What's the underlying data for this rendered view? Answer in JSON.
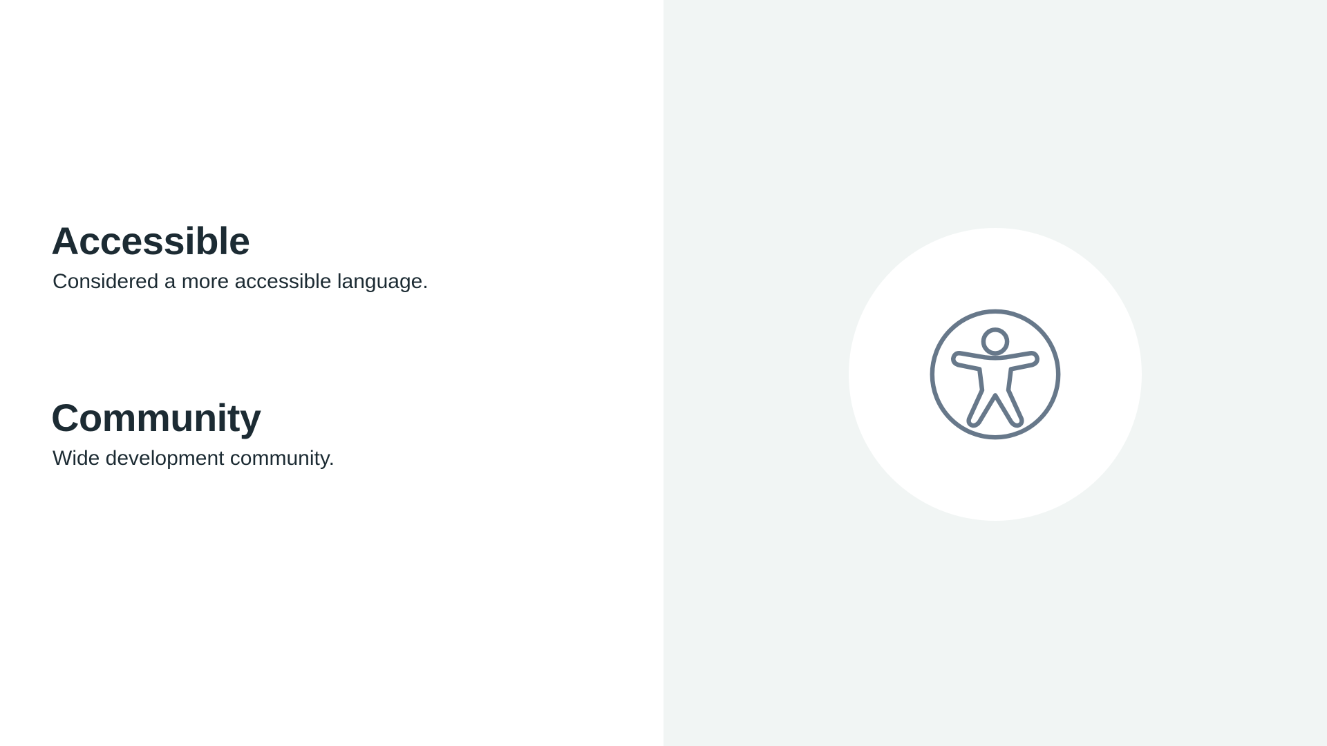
{
  "features": [
    {
      "title": "Accessible",
      "description": "Considered a more accessible language."
    },
    {
      "title": "Community",
      "description": "Wide development community."
    }
  ],
  "illustration": {
    "icon": "accessibility-icon",
    "icon_color": "#67788a",
    "panel_color": "#f1f5f4"
  },
  "colors": {
    "text": "#1c2b33",
    "background": "#ffffff"
  }
}
